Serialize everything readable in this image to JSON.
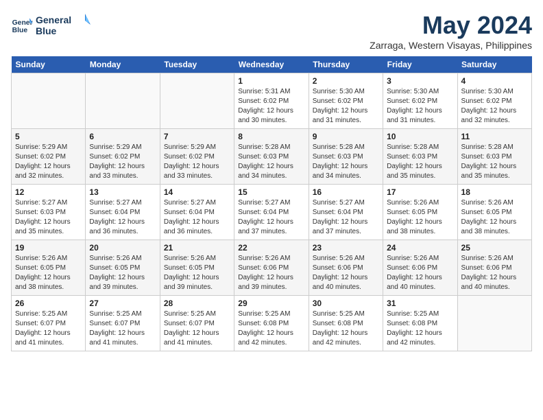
{
  "header": {
    "logo_line1": "General",
    "logo_line2": "Blue",
    "month": "May 2024",
    "location": "Zarraga, Western Visayas, Philippines"
  },
  "weekdays": [
    "Sunday",
    "Monday",
    "Tuesday",
    "Wednesday",
    "Thursday",
    "Friday",
    "Saturday"
  ],
  "weeks": [
    [
      {
        "day": "",
        "info": ""
      },
      {
        "day": "",
        "info": ""
      },
      {
        "day": "",
        "info": ""
      },
      {
        "day": "1",
        "info": "Sunrise: 5:31 AM\nSunset: 6:02 PM\nDaylight: 12 hours and 30 minutes."
      },
      {
        "day": "2",
        "info": "Sunrise: 5:30 AM\nSunset: 6:02 PM\nDaylight: 12 hours and 31 minutes."
      },
      {
        "day": "3",
        "info": "Sunrise: 5:30 AM\nSunset: 6:02 PM\nDaylight: 12 hours and 31 minutes."
      },
      {
        "day": "4",
        "info": "Sunrise: 5:30 AM\nSunset: 6:02 PM\nDaylight: 12 hours and 32 minutes."
      }
    ],
    [
      {
        "day": "5",
        "info": "Sunrise: 5:29 AM\nSunset: 6:02 PM\nDaylight: 12 hours and 32 minutes."
      },
      {
        "day": "6",
        "info": "Sunrise: 5:29 AM\nSunset: 6:02 PM\nDaylight: 12 hours and 33 minutes."
      },
      {
        "day": "7",
        "info": "Sunrise: 5:29 AM\nSunset: 6:02 PM\nDaylight: 12 hours and 33 minutes."
      },
      {
        "day": "8",
        "info": "Sunrise: 5:28 AM\nSunset: 6:03 PM\nDaylight: 12 hours and 34 minutes."
      },
      {
        "day": "9",
        "info": "Sunrise: 5:28 AM\nSunset: 6:03 PM\nDaylight: 12 hours and 34 minutes."
      },
      {
        "day": "10",
        "info": "Sunrise: 5:28 AM\nSunset: 6:03 PM\nDaylight: 12 hours and 35 minutes."
      },
      {
        "day": "11",
        "info": "Sunrise: 5:28 AM\nSunset: 6:03 PM\nDaylight: 12 hours and 35 minutes."
      }
    ],
    [
      {
        "day": "12",
        "info": "Sunrise: 5:27 AM\nSunset: 6:03 PM\nDaylight: 12 hours and 35 minutes."
      },
      {
        "day": "13",
        "info": "Sunrise: 5:27 AM\nSunset: 6:04 PM\nDaylight: 12 hours and 36 minutes."
      },
      {
        "day": "14",
        "info": "Sunrise: 5:27 AM\nSunset: 6:04 PM\nDaylight: 12 hours and 36 minutes."
      },
      {
        "day": "15",
        "info": "Sunrise: 5:27 AM\nSunset: 6:04 PM\nDaylight: 12 hours and 37 minutes."
      },
      {
        "day": "16",
        "info": "Sunrise: 5:27 AM\nSunset: 6:04 PM\nDaylight: 12 hours and 37 minutes."
      },
      {
        "day": "17",
        "info": "Sunrise: 5:26 AM\nSunset: 6:05 PM\nDaylight: 12 hours and 38 minutes."
      },
      {
        "day": "18",
        "info": "Sunrise: 5:26 AM\nSunset: 6:05 PM\nDaylight: 12 hours and 38 minutes."
      }
    ],
    [
      {
        "day": "19",
        "info": "Sunrise: 5:26 AM\nSunset: 6:05 PM\nDaylight: 12 hours and 38 minutes."
      },
      {
        "day": "20",
        "info": "Sunrise: 5:26 AM\nSunset: 6:05 PM\nDaylight: 12 hours and 39 minutes."
      },
      {
        "day": "21",
        "info": "Sunrise: 5:26 AM\nSunset: 6:05 PM\nDaylight: 12 hours and 39 minutes."
      },
      {
        "day": "22",
        "info": "Sunrise: 5:26 AM\nSunset: 6:06 PM\nDaylight: 12 hours and 39 minutes."
      },
      {
        "day": "23",
        "info": "Sunrise: 5:26 AM\nSunset: 6:06 PM\nDaylight: 12 hours and 40 minutes."
      },
      {
        "day": "24",
        "info": "Sunrise: 5:26 AM\nSunset: 6:06 PM\nDaylight: 12 hours and 40 minutes."
      },
      {
        "day": "25",
        "info": "Sunrise: 5:26 AM\nSunset: 6:06 PM\nDaylight: 12 hours and 40 minutes."
      }
    ],
    [
      {
        "day": "26",
        "info": "Sunrise: 5:25 AM\nSunset: 6:07 PM\nDaylight: 12 hours and 41 minutes."
      },
      {
        "day": "27",
        "info": "Sunrise: 5:25 AM\nSunset: 6:07 PM\nDaylight: 12 hours and 41 minutes."
      },
      {
        "day": "28",
        "info": "Sunrise: 5:25 AM\nSunset: 6:07 PM\nDaylight: 12 hours and 41 minutes."
      },
      {
        "day": "29",
        "info": "Sunrise: 5:25 AM\nSunset: 6:08 PM\nDaylight: 12 hours and 42 minutes."
      },
      {
        "day": "30",
        "info": "Sunrise: 5:25 AM\nSunset: 6:08 PM\nDaylight: 12 hours and 42 minutes."
      },
      {
        "day": "31",
        "info": "Sunrise: 5:25 AM\nSunset: 6:08 PM\nDaylight: 12 hours and 42 minutes."
      },
      {
        "day": "",
        "info": ""
      }
    ]
  ]
}
